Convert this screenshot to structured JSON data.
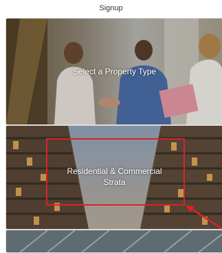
{
  "header": {
    "title": "Signup"
  },
  "cards": [
    {
      "label": "Select a Property Type"
    },
    {
      "label_line1": "Residential & Commercial",
      "label_line2": "Strata"
    },
    {
      "label": ""
    }
  ],
  "colors": {
    "highlight": "#d8232a",
    "arrow": "#d8232a"
  }
}
